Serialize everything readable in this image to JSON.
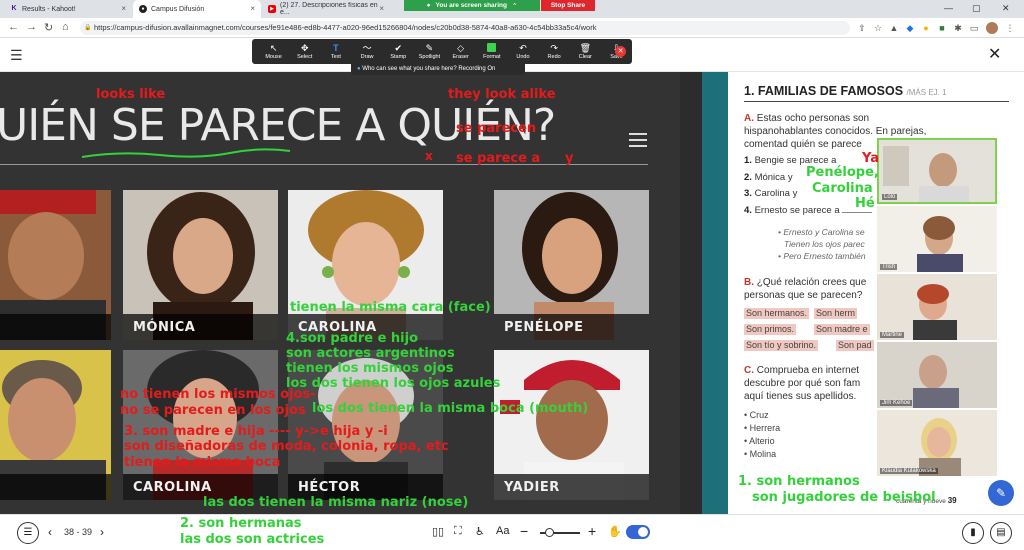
{
  "browser": {
    "tabs": [
      {
        "title": "Results - Kahoot!",
        "active": false
      },
      {
        "title": "Campus Difusión",
        "active": true
      },
      {
        "title": "(2) 27. Descripciones físicas en e...",
        "active": false
      }
    ],
    "sharing_label": "You are screen sharing",
    "stop_share_label": "Stop Share",
    "url": "https://campus-difusion.avallainmagnet.com/courses/fe91e486-ed8b-4477-a020-96ed15266804/nodes/c20b0d38-5874-40a8-a630-4c54bb33a5c4/work"
  },
  "zoom_toolbar": {
    "tools": [
      {
        "label": "Mouse",
        "icon": "↖"
      },
      {
        "label": "Select",
        "icon": "✥"
      },
      {
        "label": "Text",
        "icon": "T"
      },
      {
        "label": "Draw",
        "icon": "〜"
      },
      {
        "label": "Stamp",
        "icon": "✔"
      },
      {
        "label": "Spotlight",
        "icon": "✎"
      },
      {
        "label": "Eraser",
        "icon": "◇"
      },
      {
        "label": "Format",
        "icon": ""
      },
      {
        "label": "Undo",
        "icon": "↶"
      },
      {
        "label": "Redo",
        "icon": "↷"
      },
      {
        "label": "Clear",
        "icon": "🗑"
      },
      {
        "label": "Save",
        "icon": "⇩"
      }
    ],
    "who_can_see": "Who can see what you share here? Recording On"
  },
  "slide": {
    "title": "UIÉN SE PARECE A QUIÉN?",
    "cards": [
      {
        "name": "E"
      },
      {
        "name": "MÓNICA"
      },
      {
        "name": "CAROLINA"
      },
      {
        "name": "PENÉLOPE"
      },
      {
        "name": "TO"
      },
      {
        "name": "CAROLINA"
      },
      {
        "name": "HÉCTOR"
      },
      {
        "name": "YADIER"
      }
    ]
  },
  "book": {
    "title": "1. FAMILIAS DE FAMOSOS",
    "title_sub": "/MÁS EJ. 1",
    "a_label": "A.",
    "a_lines": [
      "Estas ocho personas son",
      "hispanohablantes conocidos. En parejas,",
      "comentad quién se parece"
    ],
    "items": [
      {
        "num": "1.",
        "text": "Bengie se parece a"
      },
      {
        "num": "2.",
        "text": "Mónica y"
      },
      {
        "num": "3.",
        "text": "Carolina y"
      },
      {
        "num": "4.",
        "text": "Ernesto se parece a"
      }
    ],
    "example_lines": [
      "• Ernesto y Carolina se",
      "Tienen los ojos parec",
      "• Pero Ernesto también"
    ],
    "b_label": "B.",
    "b_lines": [
      "¿Qué relación crees que",
      "personas que se parecen?"
    ],
    "b_tags": [
      "Son hermanos.",
      "Son herm",
      "Son primos.",
      "Son madre e",
      "Son tío y sobrino.",
      "Son pad"
    ],
    "c_label": "C.",
    "c_lines": [
      "Comprueba en internet",
      "descubre por qué son fam",
      "aquí tienes sus apellidos."
    ],
    "surnames": [
      "Cruz",
      "Herrera",
      "Alterio",
      "Molina"
    ],
    "footer": "cuarenta y nueve",
    "page_num": "39"
  },
  "participants": [
    {
      "name": "Lolo"
    },
    {
      "name": "Trish"
    },
    {
      "name": "Martine"
    },
    {
      "name": "Jim Kehoe"
    },
    {
      "name": "Klaudia Kulakowska"
    }
  ],
  "annotations": {
    "looks_like": "looks like",
    "they_look_alike": "they look alike",
    "se_parecen": "se parecen",
    "x_mark": "x",
    "se_parece_a": "se parece a",
    "y_mark": "y",
    "ya_partial": "Ya",
    "penelope_partial": "Penélope,",
    "carolina_partial": "Carolina",
    "he_partial": "Hé",
    "misma_cara": "tienen la misma cara (face)",
    "padre_hijo": "4.son padre e hijo",
    "actores": "son actores argentinos",
    "mismos_ojos": "tienen los mismos ojos",
    "ojos_azules": "los dos tienen los ojos azules",
    "misma_boca": "los dos tienen la misma boca (mouth)",
    "no_ojos": "no tienen los mismos ojos-",
    "no_parecen": "no se parecen en los ojos",
    "madre_hija": "3. son madre e hija ---- y->e  hija  y -i",
    "disenadoras": "son diseñadoras de moda, colonia, ropa, etc",
    "misma_boca2": "tienen la misma boca",
    "misma_nariz": "las dos tienen la misma nariz (nose)",
    "hermanos": "1. son hermanos",
    "beisbol": "son jugadores de beisbol",
    "hermanas": "2. son hermanas",
    "actrices": "las dos son actrices"
  },
  "bottom": {
    "pages": "38 - 39"
  }
}
